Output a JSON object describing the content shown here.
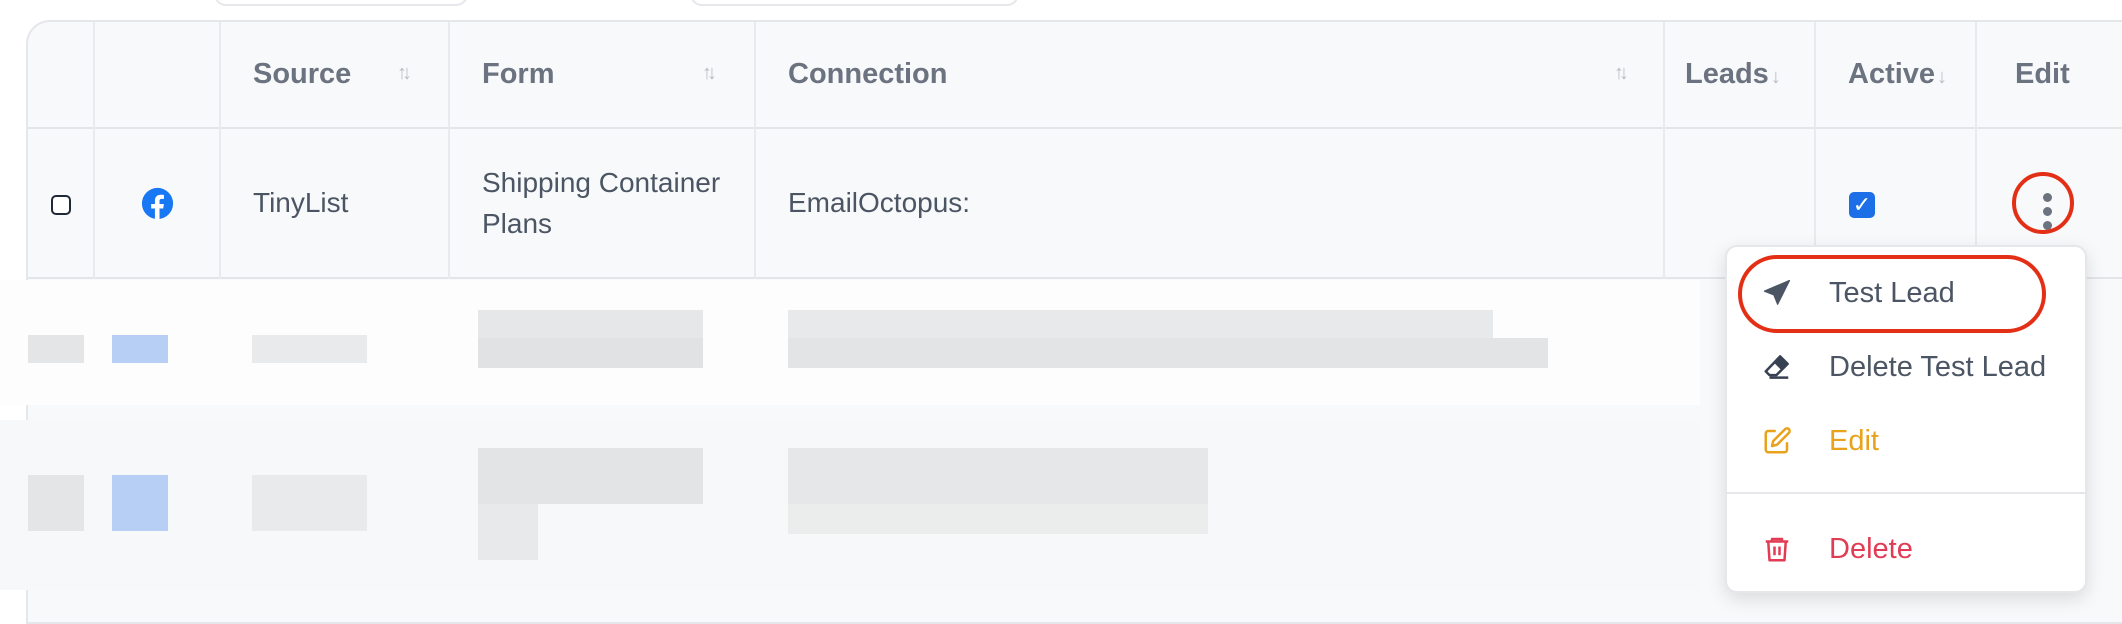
{
  "table": {
    "columns": [
      {
        "key": "select",
        "label": ""
      },
      {
        "key": "icon",
        "label": ""
      },
      {
        "key": "source",
        "label": "Source"
      },
      {
        "key": "form",
        "label": "Form"
      },
      {
        "key": "connection",
        "label": "Connection"
      },
      {
        "key": "leads",
        "label": "Leads"
      },
      {
        "key": "active",
        "label": "Active"
      },
      {
        "key": "edit",
        "label": "Edit"
      }
    ],
    "sort_glyph": "↑↓",
    "rows": [
      {
        "source_icon": "facebook-icon",
        "source": "TinyList",
        "form": "Shipping Container Plans",
        "connection": "EmailOctopus:",
        "leads": "",
        "active": true
      }
    ]
  },
  "dropdown": {
    "items": [
      {
        "label": "Test Lead",
        "icon": "paper-plane-icon",
        "color": "#4b5563"
      },
      {
        "label": "Delete Test Lead",
        "icon": "eraser-icon",
        "color": "#4b5563"
      },
      {
        "label": "Edit",
        "icon": "pencil-square-icon",
        "color": "#e8a21b"
      },
      {
        "label": "Delete",
        "icon": "trash-icon",
        "color": "#e23b55"
      }
    ]
  },
  "colors": {
    "accent_blue": "#1d6fe8",
    "facebook_blue": "#1877f2",
    "annotation_red": "#e32f16"
  }
}
